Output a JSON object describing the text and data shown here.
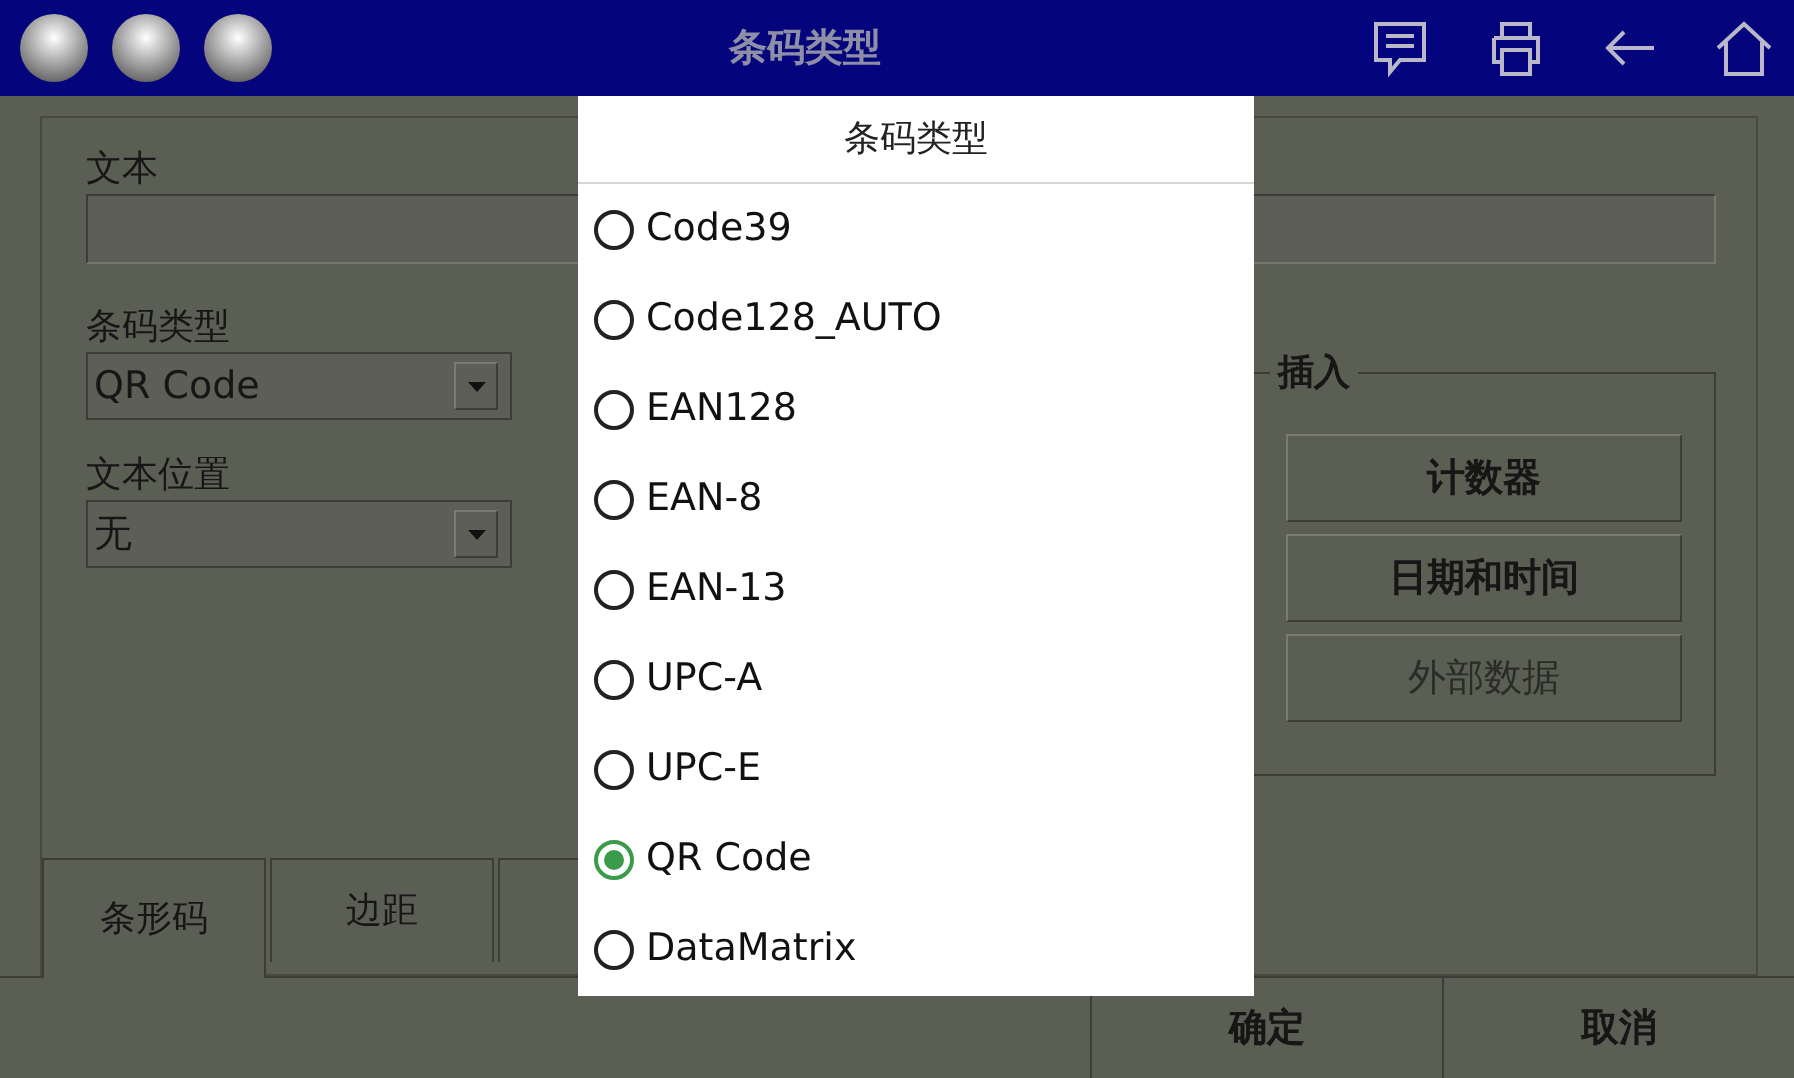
{
  "window": {
    "title": "条码类型"
  },
  "form": {
    "text": {
      "label": "文本"
    },
    "barcode_type": {
      "label": "条码类型",
      "value": "QR Code"
    },
    "text_position": {
      "label": "文本位置",
      "value": "无"
    }
  },
  "insert_group": {
    "title": "插入",
    "buttons": [
      {
        "label": "计数器",
        "disabled": false
      },
      {
        "label": "日期和时间",
        "disabled": false
      },
      {
        "label": "外部数据",
        "disabled": true
      }
    ]
  },
  "tabs": [
    {
      "label": "条形码",
      "selected": true
    },
    {
      "label": "边距",
      "selected": false
    },
    {
      "selected": false
    }
  ],
  "footer_buttons": [
    "确定",
    "取消"
  ],
  "popup": {
    "title": "条码类型",
    "options": [
      {
        "label": "Code39",
        "selected": false
      },
      {
        "label": "Code128_AUTO",
        "selected": false
      },
      {
        "label": "EAN128",
        "selected": false
      },
      {
        "label": "EAN-8",
        "selected": false
      },
      {
        "label": "EAN-13",
        "selected": false
      },
      {
        "label": "UPC-A",
        "selected": false
      },
      {
        "label": "UPC-E",
        "selected": false
      },
      {
        "label": "QR Code",
        "selected": true
      },
      {
        "label": "DataMatrix",
        "selected": false
      }
    ]
  }
}
